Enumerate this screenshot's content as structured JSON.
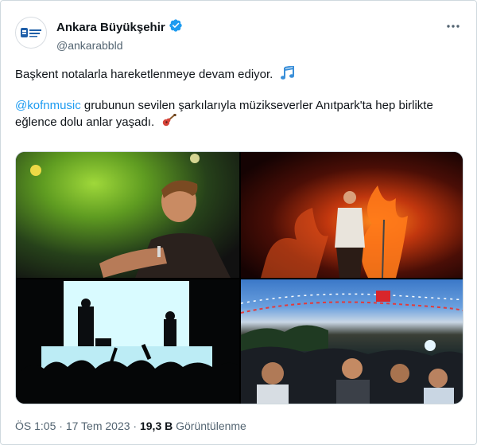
{
  "user": {
    "display_name": "Ankara Büyükşehir",
    "handle": "@ankarabbld"
  },
  "tweet": {
    "line1": "Başkent notalarla hareketlenmeye devam ediyor.",
    "mention": "@kofnmusic",
    "line2_rest": " grubunun sevilen şarkılarıyla müzikseverler Anıtpark'ta hep birlikte eğlence dolu anlar yaşadı."
  },
  "meta": {
    "time": "ÖS 1:05",
    "separator": "·",
    "date": "17 Tem 2023",
    "views_count": "19,3 B",
    "views_label": "Görüntülenme"
  },
  "icons": {
    "verified": "verified-badge-icon",
    "more": "more-dots-icon",
    "music": "musical-notes-emoji",
    "guitar": "guitar-emoji"
  },
  "colors": {
    "accent": "#1d9bf0",
    "text": "#0f1419",
    "muted": "#536471"
  }
}
